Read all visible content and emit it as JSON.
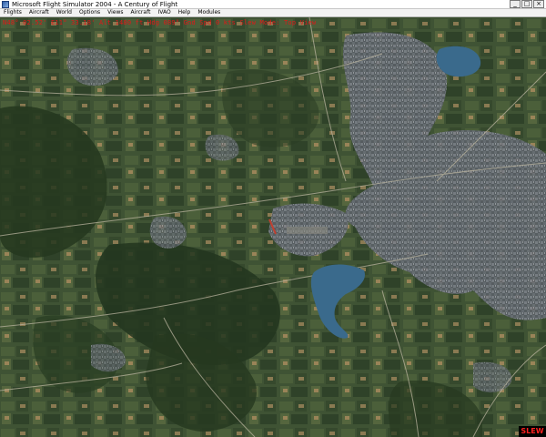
{
  "window": {
    "title": "Microsoft Flight Simulator 2004 - A Century of Flight",
    "buttons": {
      "minimize": "_",
      "maximize": "□",
      "close": "×"
    }
  },
  "menu": {
    "items": [
      {
        "label": "Flights"
      },
      {
        "label": "Aircraft"
      },
      {
        "label": "World"
      },
      {
        "label": "Options"
      },
      {
        "label": "Views"
      },
      {
        "label": "Aircraft"
      },
      {
        "label": "IVAO"
      },
      {
        "label": "Help"
      },
      {
        "label": "Modules"
      }
    ]
  },
  "hud": {
    "status_text": "N48° 02.52' E11° 33.18'   Alt 1480 ft   Hdg 089°   Gnd Spd 0 kts   Slew Mode: Top View"
  },
  "mode_indicator": {
    "label": "SLEW",
    "color": "#ff2020"
  },
  "colors": {
    "terrain_base": "#3e5234",
    "hud_text": "#e01818",
    "lake_water": "#3a6a8c"
  },
  "icons": {
    "app": "flight-simulator-icon",
    "minimize": "minimize-icon",
    "maximize": "maximize-icon",
    "close": "close-icon"
  }
}
